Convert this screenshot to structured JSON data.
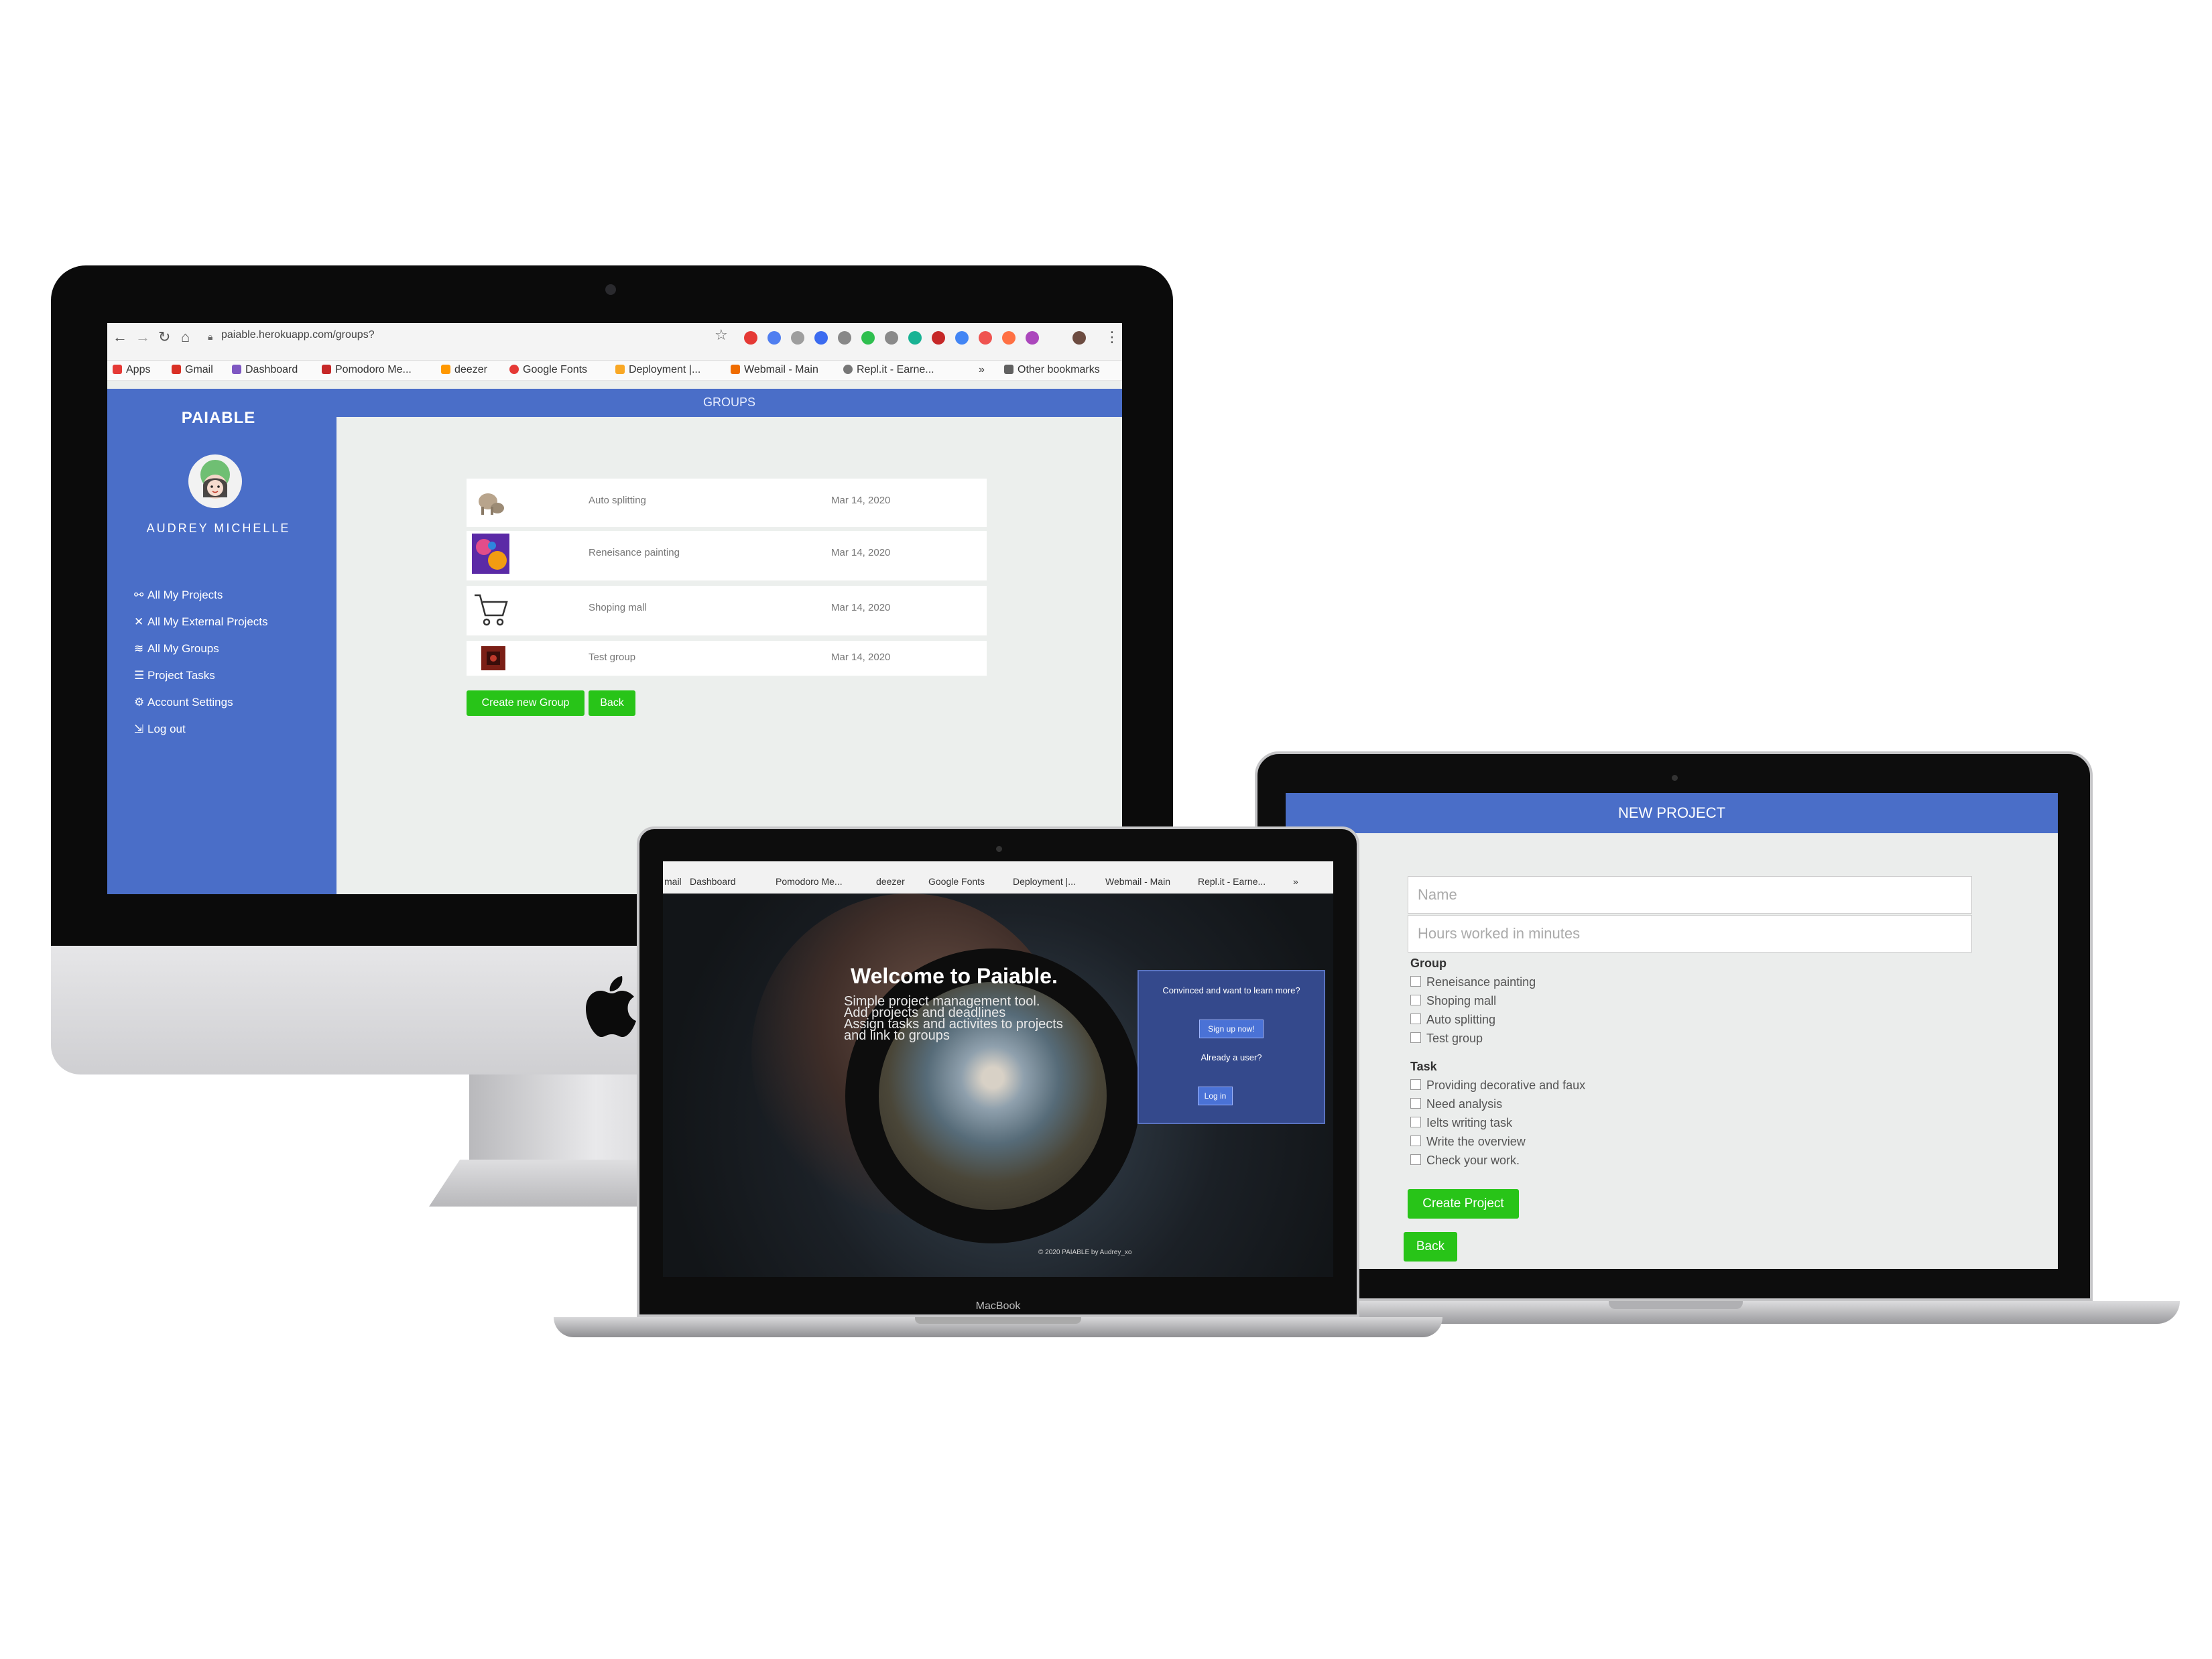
{
  "imac": {
    "browser": {
      "url": "paiable.herokuapp.com/groups?",
      "bookmarks": [
        "Apps",
        "Gmail",
        "Dashboard",
        "Pomodoro Me...",
        "deezer",
        "Google Fonts",
        "Deployment |...",
        "Webmail - Main",
        "Repl.it - Earne...",
        "»",
        "Other bookmarks"
      ]
    },
    "app": {
      "brand": "PAIABLE",
      "user_name": "AUDREY MICHELLE",
      "page_title": "GROUPS",
      "nav": [
        "All My Projects",
        "All My External Projects",
        "All My Groups",
        "Project Tasks",
        "Account Settings",
        "Log out"
      ],
      "groups": [
        {
          "name": "Auto splitting",
          "date": "Mar 14, 2020"
        },
        {
          "name": "Reneisance painting",
          "date": "Mar 14, 2020"
        },
        {
          "name": "Shoping mall",
          "date": "Mar 14, 2020"
        },
        {
          "name": "Test group",
          "date": "Mar 14, 2020"
        }
      ],
      "create_button": "Create new Group",
      "back_button": "Back"
    }
  },
  "macbook_front": {
    "bookmarks": [
      "mail",
      "Dashboard",
      "Pomodoro Me...",
      "deezer",
      "Google Fonts",
      "Deployment |...",
      "Webmail - Main",
      "Repl.it - Earne...",
      "»"
    ],
    "welcome": "Welcome to Paiable.",
    "tagline": [
      "Simple project management tool.",
      "Add projects and deadlines",
      "Assign tasks and activites to projects",
      "and link to groups"
    ],
    "cta_text": "Convinced and want to learn more?",
    "signup": "Sign up now!",
    "already": "Already a user?",
    "login": "Log in",
    "footer": "© 2020 PAIABLE by Audrey_xo",
    "device_label": "MacBook"
  },
  "macbook_right": {
    "title": "NEW PROJECT",
    "name_placeholder": "Name",
    "hours_placeholder": "Hours worked in minutes",
    "group_label": "Group",
    "groups": [
      "Reneisance painting",
      "Shoping mall",
      "Auto splitting",
      "Test group"
    ],
    "task_label": "Task",
    "tasks": [
      "Providing decorative and faux",
      "Need analysis",
      "Ielts writing task",
      "Write the overview",
      "Check your work."
    ],
    "create_button": "Create Project",
    "back_button": "Back"
  },
  "colors": {
    "brand_blue": "#4a6ec8",
    "accent_green": "#28c418"
  }
}
